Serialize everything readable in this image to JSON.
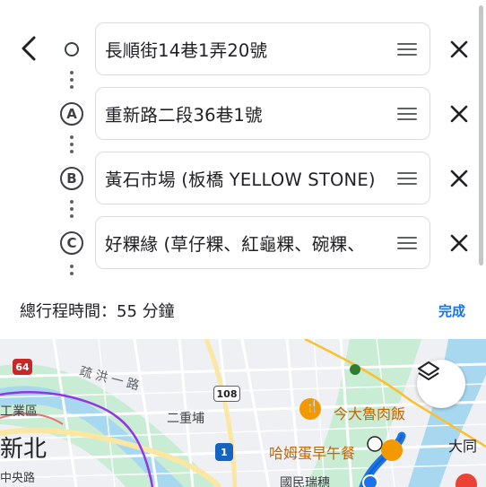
{
  "stops": [
    {
      "marker": "",
      "text": "長順街14巷1弄20號"
    },
    {
      "marker": "A",
      "text": "重新路二段36巷1號"
    },
    {
      "marker": "B",
      "text": "黃石市場 (板橋 YELLOW STONE)"
    },
    {
      "marker": "C",
      "text": "好粿緣 (草仔粿、紅龜粿、碗粿、"
    }
  ],
  "summary": {
    "total_time": "總行程時間：55 分鐘",
    "done_label": "完成"
  },
  "map": {
    "labels": {
      "road_64": "64",
      "road_108": "108",
      "road_1": "1",
      "shulong_road": "疏洪一路",
      "sanchong_pu": "二重埔",
      "industrial_zone": "工業區",
      "new_taipei": "新北",
      "zhong_road": "中央路",
      "jinda": "今大魯肉飯",
      "hamu": "哈姆蛋早午餐",
      "datong": "大同",
      "national": "國民瑞穗"
    },
    "colors": {
      "river": "#a8d8f0",
      "route_purple": "#9334e6",
      "route_blue": "#1a73e8",
      "food_orange": "#f29900"
    }
  },
  "colors": {
    "accent": "#1a73e8",
    "text": "#202124",
    "border": "#dadce0"
  }
}
